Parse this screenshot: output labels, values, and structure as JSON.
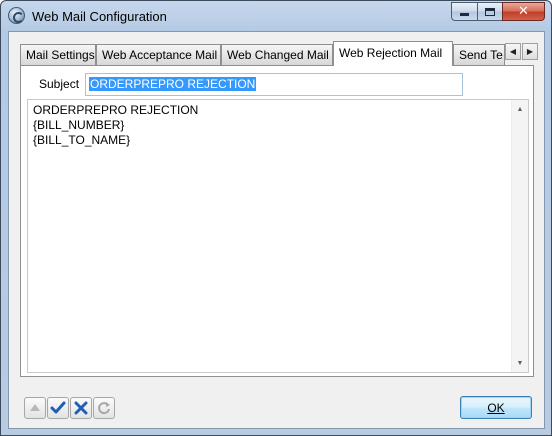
{
  "window": {
    "title": "Web Mail Configuration"
  },
  "tabs": [
    {
      "label": "Mail Settings",
      "active": false
    },
    {
      "label": "Web Acceptance Mail",
      "active": false
    },
    {
      "label": "Web Changed Mail",
      "active": false
    },
    {
      "label": "Web Rejection Mail",
      "active": true
    },
    {
      "label": "Send Te",
      "active": false
    }
  ],
  "form": {
    "subject_label": "Subject",
    "subject_value": "ORDERPREPRO REJECTION",
    "body_lines": [
      "ORDERPREPRO REJECTION",
      "{BILL_NUMBER}",
      "{BILL_TO_NAME}"
    ]
  },
  "buttons": {
    "ok_label": "OK"
  },
  "icons": {
    "app": "web-mail-icon",
    "move_up": "arrow-up-icon",
    "confirm": "checkmark-icon",
    "cancel": "x-icon",
    "refresh": "refresh-icon"
  },
  "colors": {
    "selection": "#3399ff",
    "confirm_blue": "#1f5fb5"
  }
}
